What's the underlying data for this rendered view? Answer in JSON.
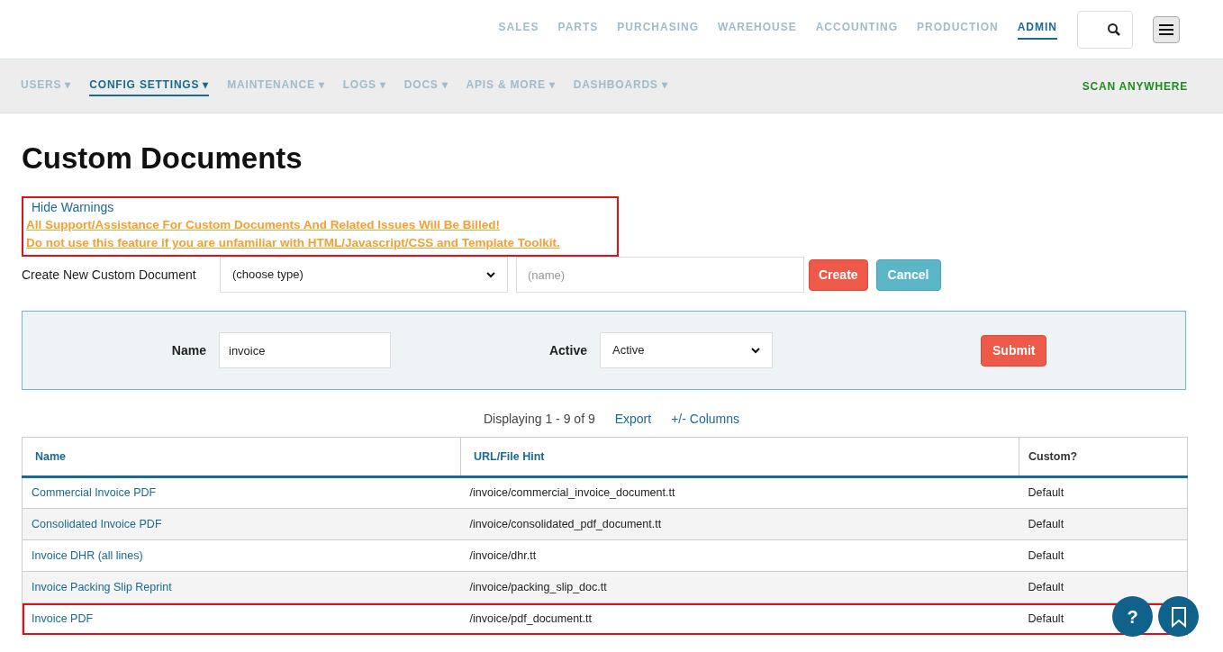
{
  "top_nav": [
    {
      "label": "SALES",
      "selected": false
    },
    {
      "label": "PARTS",
      "selected": false
    },
    {
      "label": "PURCHASING",
      "selected": false
    },
    {
      "label": "WAREHOUSE",
      "selected": false
    },
    {
      "label": "ACCOUNTING",
      "selected": false
    },
    {
      "label": "PRODUCTION",
      "selected": false
    },
    {
      "label": "ADMIN",
      "selected": true
    }
  ],
  "sub_nav": [
    {
      "label": "USERS ▾",
      "selected": false
    },
    {
      "label": "CONFIG SETTINGS ▾",
      "selected": true
    },
    {
      "label": "MAINTENANCE ▾",
      "selected": false
    },
    {
      "label": "LOGS ▾",
      "selected": false
    },
    {
      "label": "DOCS ▾",
      "selected": false
    },
    {
      "label": "APIS & MORE ▾",
      "selected": false
    },
    {
      "label": "DASHBOARDS ▾",
      "selected": false
    }
  ],
  "sub_nav_action": "SCAN ANYWHERE",
  "page_title": "Custom Documents",
  "warnings": {
    "highlighted": true,
    "toggle": "Hide Warnings",
    "lines": [
      "All Support/Assistance For Custom Documents And Related Issues Will Be Billed!",
      "Do not use this feature if you are unfamiliar with HTML/Javascript/CSS and Template Toolkit."
    ]
  },
  "create": {
    "label": "Create New Custom Document",
    "type_value": "(choose type)",
    "name_placeholder": "(name)",
    "buttons": [
      "Create",
      "Cancel"
    ]
  },
  "filter": {
    "name_label": "Name",
    "name_value": "invoice",
    "active_label": "Active",
    "active_value": "Active",
    "submit": "Submit"
  },
  "table_info": {
    "summary": "Displaying 1 - 9 of 9",
    "links": [
      "Export",
      "+/- Columns"
    ]
  },
  "table": {
    "columns": [
      {
        "label": "Name",
        "sortable": true
      },
      {
        "label": "URL/File Hint",
        "sortable": true
      },
      {
        "label": "Custom?",
        "sortable": false
      }
    ],
    "rows": [
      {
        "name": "Commercial Invoice PDF",
        "url": "/invoice/commercial_invoice_document.tt",
        "custom": "Default",
        "highlighted": false
      },
      {
        "name": "Consolidated Invoice PDF",
        "url": "/invoice/consolidated_pdf_document.tt",
        "custom": "Default",
        "highlighted": false
      },
      {
        "name": "Invoice DHR (all lines)",
        "url": "/invoice/dhr.tt",
        "custom": "Default",
        "highlighted": false
      },
      {
        "name": "Invoice Packing Slip Reprint",
        "url": "/invoice/packing_slip_doc.tt",
        "custom": "Default",
        "highlighted": false
      },
      {
        "name": "Invoice PDF",
        "url": "/invoice/pdf_document.tt",
        "custom": "Default",
        "highlighted": true
      }
    ]
  },
  "help_button": "?"
}
